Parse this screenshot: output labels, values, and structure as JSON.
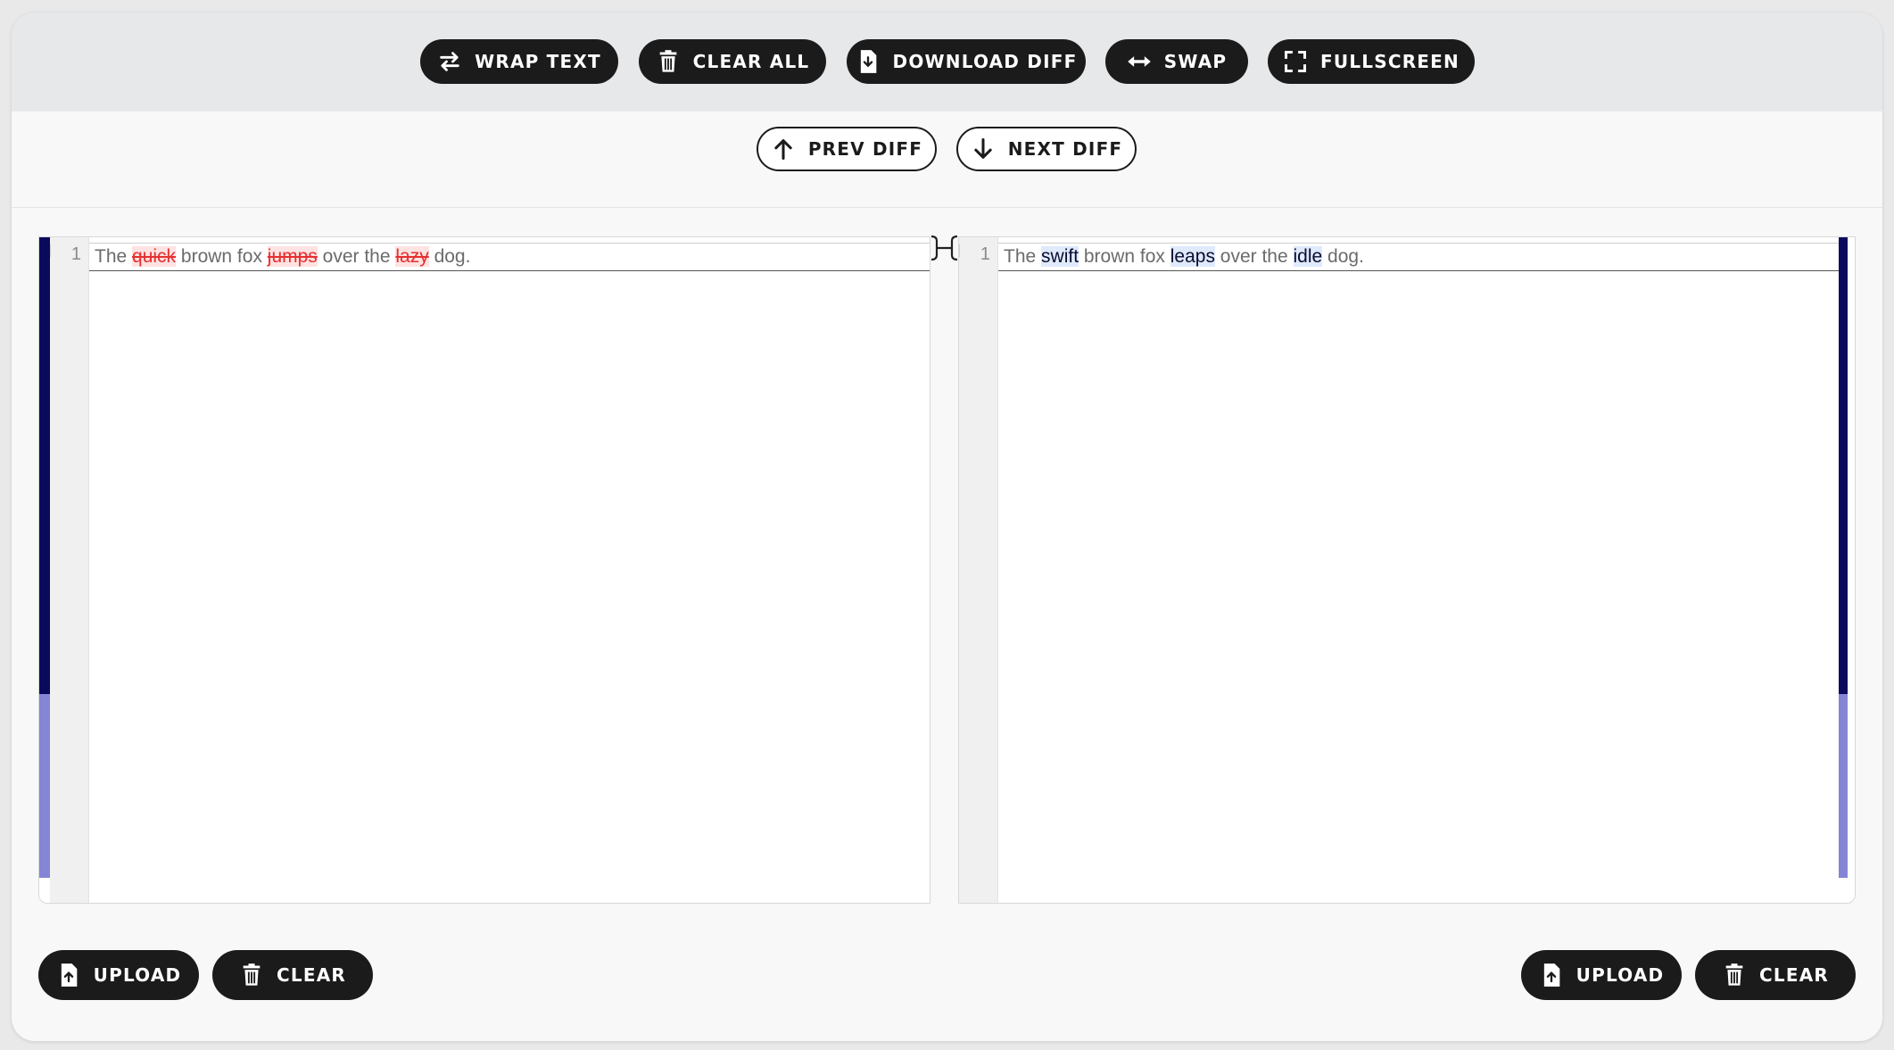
{
  "toolbar": {
    "wrap_text": "WRAP TEXT",
    "clear_all": "CLEAR ALL",
    "download_diff": "DOWNLOAD DIFF",
    "swap": "SWAP",
    "fullscreen": "FULLSCREEN"
  },
  "navigation": {
    "prev_diff": "PREV DIFF",
    "next_diff": "NEXT DIFF"
  },
  "left_editor": {
    "line_number": "1",
    "segments": [
      "The ",
      "quick",
      " brown fox ",
      "jumps",
      " over the ",
      "lazy",
      " dog."
    ]
  },
  "right_editor": {
    "line_number": "1",
    "segments": [
      "The ",
      "swift",
      " brown fox ",
      "leaps",
      " over the ",
      "idle",
      " dog."
    ]
  },
  "left_actions": {
    "upload": "UPLOAD",
    "clear": "CLEAR"
  },
  "right_actions": {
    "upload": "UPLOAD",
    "clear": "CLEAR"
  },
  "colors": {
    "button_dark": "#1b1b1b",
    "deleted_text": "#e53030",
    "inserted_highlight": "#dfeafd",
    "scrollbar_dark": "#0a0a5c",
    "scrollbar_light": "#8585d6"
  }
}
